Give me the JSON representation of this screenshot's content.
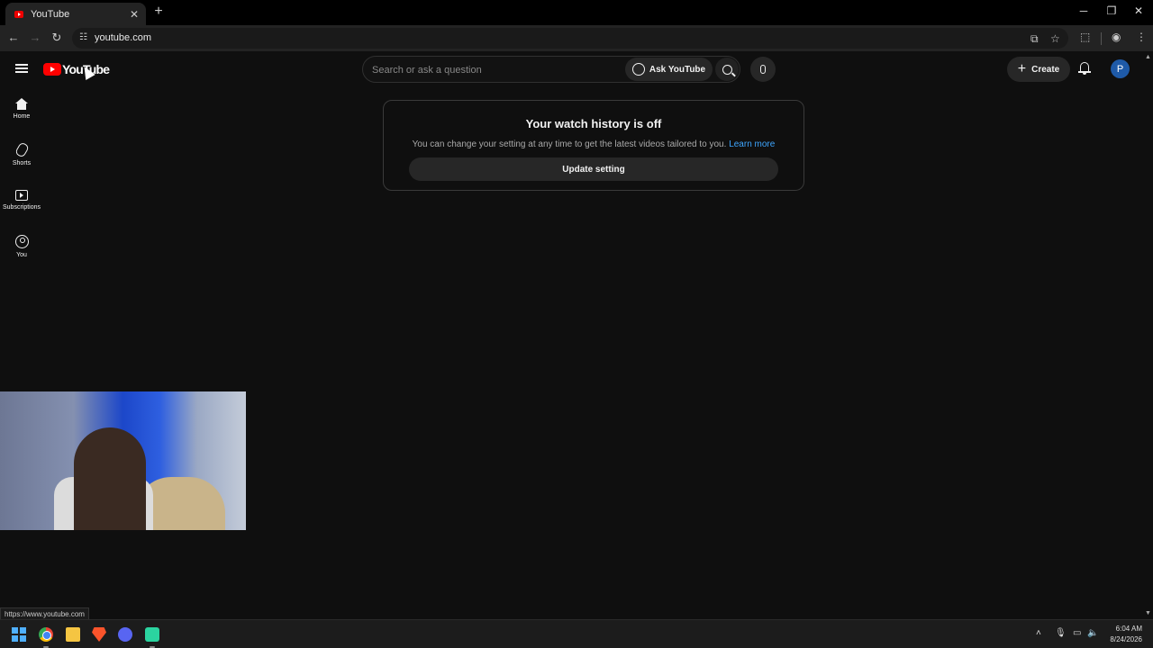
{
  "browser": {
    "tab_title": "YouTube",
    "tab_close": "✕",
    "new_tab": "+",
    "url": "youtube.com",
    "window_controls": {
      "minimize": "─",
      "restore": "❐",
      "close": "✕"
    },
    "nav": {
      "back": "←",
      "forward": "→",
      "reload": "↻"
    },
    "status_url": "https://www.youtube.com"
  },
  "youtube": {
    "logo_text": "YouTube",
    "search_placeholder": "Search or ask a question",
    "ask_label": "Ask YouTube",
    "create_label": "Create",
    "avatar_letter": "P"
  },
  "sidebar": {
    "items": [
      {
        "label": "Home",
        "icon": "home-icon"
      },
      {
        "label": "Shorts",
        "icon": "shorts-icon"
      },
      {
        "label": "Subscriptions",
        "icon": "subscriptions-icon"
      },
      {
        "label": "You",
        "icon": "you-icon"
      }
    ]
  },
  "history_card": {
    "title": "Your watch history is off",
    "description": "You can change your setting at any time to get the latest videos tailored to you.",
    "link": "Learn more",
    "button": "Update setting"
  },
  "taskbar": {
    "time": "6:04 AM",
    "date": "8/24/2026"
  },
  "colors": {
    "background": "#0f0f0f",
    "brand_red": "#ff0000",
    "link_blue": "#3ea6ff",
    "avatar_blue": "#1e5aa8"
  }
}
